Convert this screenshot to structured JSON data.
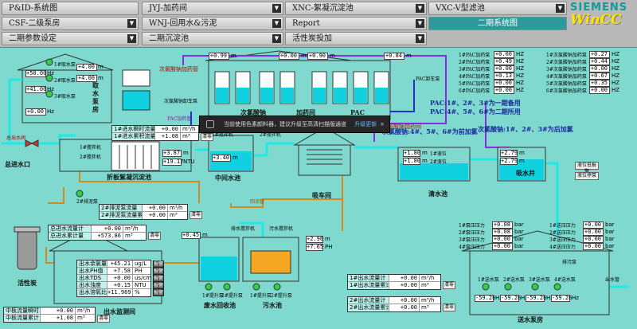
{
  "nav": {
    "row1": [
      "P&ID-系统图",
      "JYJ-加药间",
      "XNC-絮凝沉淀池",
      "VXC-V型滤池"
    ],
    "row2": [
      "CSF-二级泵房",
      "WNJ-回用水&污泥",
      "Report",
      "二期系统图"
    ],
    "row3": [
      "二期参数设定",
      "二期沉淀池",
      "活性炭投加"
    ],
    "active": "二期系统图"
  },
  "brand": {
    "siemens": "SIEMENS",
    "wincc": "WinCC"
  },
  "popup": {
    "text": "当前使用色素颜料器，建议升级至高清扫描版通道",
    "action": "升级更新",
    "close": "×"
  },
  "intake": {
    "title": "取水泵房",
    "level_values": [
      "+50.00",
      "+41.00",
      "+0.00"
    ],
    "level_units": [
      "Hz",
      "Hz",
      "Hz"
    ],
    "pump_labels": [
      "1#取水泵",
      "2#取水泵",
      "3#取水泵"
    ],
    "flow_values": [
      "+4.00",
      "+4.00"
    ],
    "flow_units": [
      "m",
      "m"
    ],
    "left_label": "总进水口",
    "inlet_label": "总出水阀"
  },
  "top_meters": [
    {
      "value": "+0.99",
      "unit": "m"
    },
    {
      "value": "+0.00",
      "unit": "m"
    },
    {
      "value": "+0.90",
      "unit": "m"
    },
    {
      "value": "+0.84",
      "unit": "m"
    }
  ],
  "top_labels": {
    "cl_pipe": "次氯酸钠加药管",
    "cl_room": "次氯酸钠加药间",
    "pac_pipe": "PAC加药管",
    "chlorine": "次氯酸钠",
    "dosing": "加药间",
    "pac": "PAC",
    "pac_pump": "PAC卸车泵",
    "cl_pump": "次氯酸钠卸车泵"
  },
  "dose_left": {
    "labels": [
      "1#PAC加药泵",
      "2#PAC加药泵",
      "3#PAC加药泵",
      "4#PAC加药泵",
      "5#PAC加药泵",
      "6#PAC加药泵"
    ],
    "values": [
      "+0.00",
      "+0.49",
      "+0.00",
      "+0.13",
      "+0.00",
      "+0.00"
    ],
    "unit": "HZ"
  },
  "dose_right": {
    "labels": [
      "1#次氯酸钠加药泵",
      "2#次氯酸钠加药泵",
      "3#次氯酸钠加药泵",
      "4#次氯酸钠加药泵",
      "5#次氯酸钠加药泵",
      "6#次氯酸钠加药泵"
    ],
    "values": [
      "+0.27",
      "+0.44",
      "+0.00",
      "+0.67",
      "+0.35",
      "+0.00"
    ],
    "unit": "HZ"
  },
  "pac_note": [
    "PAC:1#、2#、3#为一期备用",
    "PAC:4#、5#、6#为二期所用"
  ],
  "cl_note": [
    "次氯酸钠:1#、2#、3#为后加氯",
    "次氯酸钠:4#、5#、6#为前加氯"
  ],
  "sed": {
    "title": "折板絮凝沉淀池",
    "flow_rows": [
      {
        "key": "1#进水瞬时流量",
        "value": "+0.00",
        "unit": "m³/h"
      },
      {
        "key": "1#进水累积流量",
        "value": "+1.08",
        "unit": "m³"
      }
    ],
    "level": {
      "value": "+3.87",
      "unit": "m"
    },
    "turb": {
      "value": "+19.17",
      "unit": "NTU"
    },
    "clear": "清零",
    "mixers": [
      "1#搅拌机",
      "2#搅拌机"
    ],
    "sludge_flow_rows": [
      {
        "key": "2#排泥泵流量",
        "value": "+0.00",
        "unit": "m³/h"
      },
      {
        "key": "2#排泥泵流量累计",
        "value": "+0.00",
        "unit": "m³"
      }
    ],
    "drain_pump": "2#排泥泵"
  },
  "mid_pool": {
    "title": "中间水池",
    "level": {
      "value": "+3.40",
      "unit": "m"
    },
    "mixers": [
      "1#搅拌机",
      "2#搅拌机"
    ]
  },
  "pump_house": {
    "title": "吸车间"
  },
  "clear_pool": {
    "title": "清水池",
    "levels": [
      {
        "value": "+1.80",
        "unit": "m"
      },
      {
        "value": "+1.80",
        "unit": "m"
      }
    ],
    "tags": [
      "1#液位",
      "2#液位"
    ]
  },
  "suction_well": {
    "title": "吸水井",
    "levels": [
      {
        "value": "+2.79",
        "unit": "m"
      },
      {
        "value": "+2.79",
        "unit": "m"
      }
    ],
    "btns": [
      "液位低报警",
      "液位停泵"
    ]
  },
  "total_flow": {
    "rows": [
      {
        "key": "总进水流量计",
        "value": "+0.00",
        "unit": "m³/h"
      },
      {
        "key": "总进水累计量",
        "value": "+573.86",
        "unit": "m³"
      }
    ],
    "clear": "清零"
  },
  "sludge_level": {
    "value": "+0.45",
    "unit": "m"
  },
  "backwash": {
    "title": "废水回收池",
    "pumps": [
      "1#提升泵",
      "2#提升泵"
    ],
    "labels": [
      "排水搅拌机",
      "回流管"
    ]
  },
  "sewage": {
    "title": "污水池",
    "pumps": [
      "1#提升泵",
      "2#提升泵"
    ],
    "mixer": "污水搅拌机",
    "ph": {
      "value": "+7.65",
      "unit": "PH"
    },
    "lvl": {
      "value": "+2.96",
      "unit": "m"
    }
  },
  "carbon": {
    "title": "活性炭"
  },
  "quality": {
    "title": "出水监测间",
    "rows": [
      {
        "key": "出水余氯量",
        "value": "+45.21",
        "unit": "ug/L"
      },
      {
        "key": "出水PH值",
        "value": "+7.58",
        "unit": "PH"
      },
      {
        "key": "出水TDS",
        "value": "+0.00",
        "unit": "us/cm"
      },
      {
        "key": "出水浊度",
        "value": "+0.15",
        "unit": "NTU"
      },
      {
        "key": "出水溶氧比料",
        "value": "+11.969",
        "unit": "%"
      }
    ],
    "alarm": "报警"
  },
  "bottom_left": {
    "rows": [
      {
        "key": "中板流量瞬时",
        "value": "+0.00",
        "unit": "m³/h"
      },
      {
        "key": "中板流量累计",
        "value": "+1.08",
        "unit": "m³"
      }
    ],
    "clear": "清零"
  },
  "out_flow": {
    "rows": [
      {
        "key": "1#出水流量计",
        "value": "+0.00",
        "unit": "m³/h"
      },
      {
        "key": "1#出水流量累计",
        "value": "+0.00",
        "unit": "m³"
      }
    ],
    "rows2": [
      {
        "key": "2#出水流量计",
        "value": "+0.00",
        "unit": "m³/h"
      },
      {
        "key": "2#出水流量累计",
        "value": "+0.00",
        "unit": "m³"
      }
    ],
    "clear": "清零"
  },
  "pressure_left": {
    "labels": [
      "1#泵压压力",
      "2#泵压压力",
      "3#泵压压力",
      "4#泵压压力"
    ],
    "values": [
      "+0.08",
      "+0.08",
      "+0.00",
      "+0.00"
    ],
    "unit": "bar"
  },
  "pressure_right": {
    "labels": [
      "1#送压压力",
      "2#送压压力",
      "3#送压压力",
      "4#送压压力"
    ],
    "values": [
      "+0.00",
      "+0.00",
      "+0.00",
      "+0.00"
    ],
    "unit": "bar"
  },
  "send_pumps": {
    "title": "送水泵房",
    "pumps": [
      "1#送水泵",
      "2#送水泵",
      "3#送水泵",
      "4#送水泵"
    ],
    "hz": [
      "-59.26",
      "-59.26",
      "-59.26",
      "-59.26"
    ],
    "unit": "Hz",
    "drain": "排污泵",
    "out": "出水管"
  },
  "colors": {
    "bg": "#7fd9cf",
    "pipe_cyan": "#23e6e6",
    "pipe_orange": "#d28a1f",
    "pipe_purple": "#8a2be2",
    "pipe_blue": "#1f30d8",
    "water": "#0fd1e0"
  }
}
